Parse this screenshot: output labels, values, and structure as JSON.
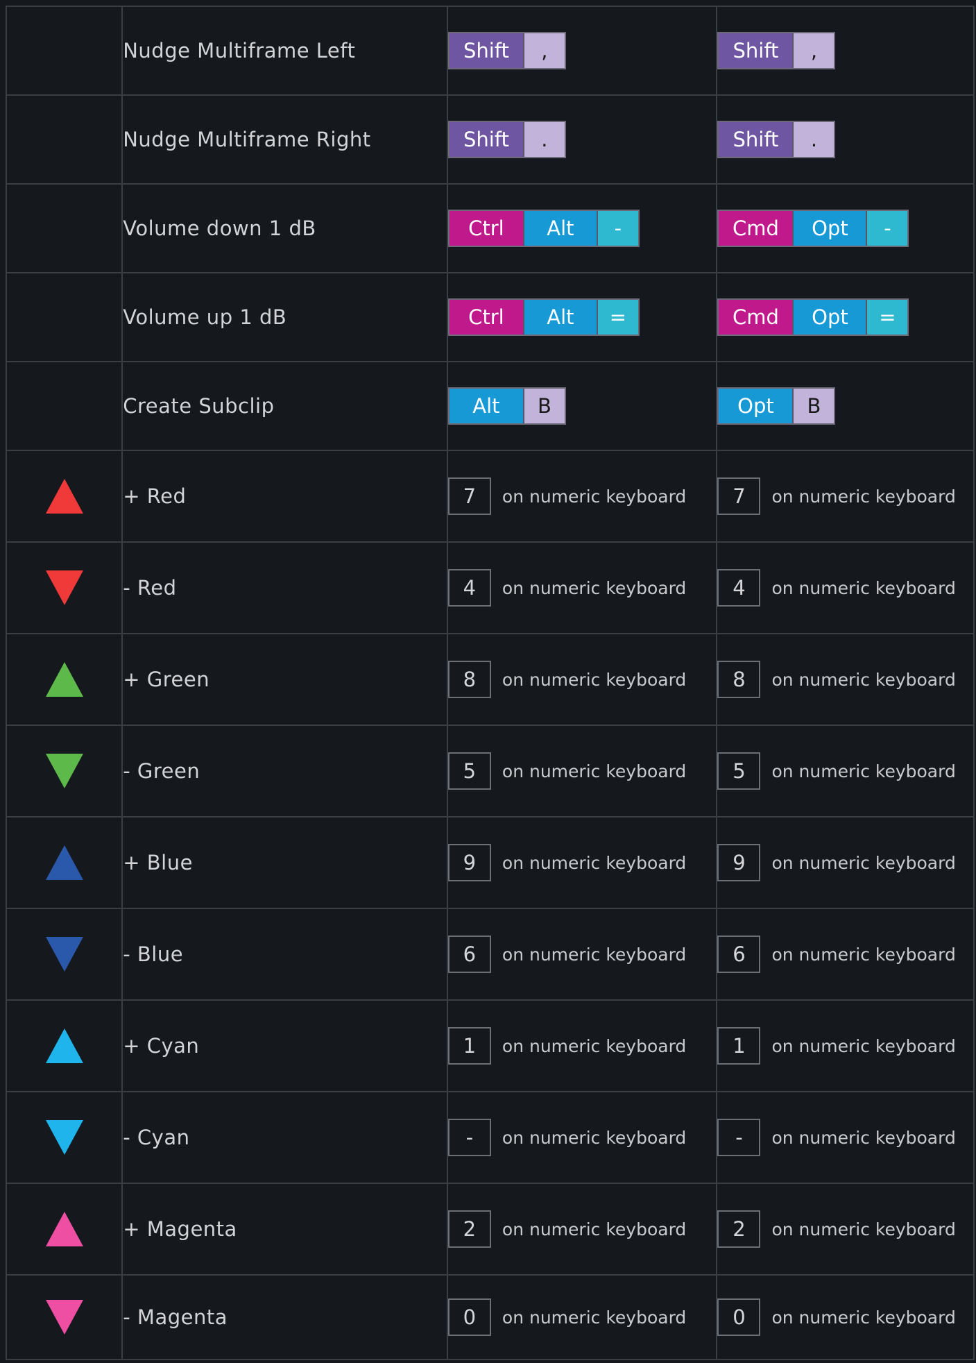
{
  "colors": {
    "red": "#f03a3a",
    "green": "#5cb94a",
    "blue": "#2a59ab",
    "cyan": "#1fb4ec",
    "magenta": "#ee4fa2",
    "shift_key": "#6f56a3",
    "ctrl_key": "#c0198b",
    "alt_key": "#1799d6",
    "light_key": "#c1b3d9",
    "teal_key": "#2fb9d0",
    "background": "#15181d",
    "border": "#3a3f46"
  },
  "shortcut_rows": [
    {
      "name": "Nudge Multiframe Left",
      "windows": [
        {
          "label": "Shift",
          "style": "shift"
        },
        {
          "label": ",",
          "style": "light"
        }
      ],
      "mac": [
        {
          "label": "Shift",
          "style": "shift"
        },
        {
          "label": ",",
          "style": "light"
        }
      ]
    },
    {
      "name": "Nudge Multiframe Right",
      "windows": [
        {
          "label": "Shift",
          "style": "shift"
        },
        {
          "label": ".",
          "style": "light"
        }
      ],
      "mac": [
        {
          "label": "Shift",
          "style": "shift"
        },
        {
          "label": ".",
          "style": "light"
        }
      ]
    },
    {
      "name": "Volume down 1 dB",
      "windows": [
        {
          "label": "Ctrl",
          "style": "ctrl"
        },
        {
          "label": "Alt",
          "style": "alt"
        },
        {
          "label": "-",
          "style": "teal"
        }
      ],
      "mac": [
        {
          "label": "Cmd",
          "style": "ctrl"
        },
        {
          "label": "Opt",
          "style": "alt"
        },
        {
          "label": "-",
          "style": "teal"
        }
      ]
    },
    {
      "name": "Volume up 1 dB",
      "windows": [
        {
          "label": "Ctrl",
          "style": "ctrl"
        },
        {
          "label": "Alt",
          "style": "alt"
        },
        {
          "label": "=",
          "style": "teal"
        }
      ],
      "mac": [
        {
          "label": "Cmd",
          "style": "ctrl"
        },
        {
          "label": "Opt",
          "style": "alt"
        },
        {
          "label": "=",
          "style": "teal"
        }
      ]
    },
    {
      "name": "Create Subclip",
      "windows": [
        {
          "label": "Alt",
          "style": "alt"
        },
        {
          "label": "B",
          "style": "light"
        }
      ],
      "mac": [
        {
          "label": "Opt",
          "style": "alt"
        },
        {
          "label": "B",
          "style": "light"
        }
      ]
    }
  ],
  "color_rows": [
    {
      "icon": "red-triangle-up-icon",
      "direction": "up",
      "color": "red",
      "name": "+ Red",
      "key": "7",
      "suffix": "on numeric keyboard"
    },
    {
      "icon": "red-triangle-down-icon",
      "direction": "down",
      "color": "red",
      "name": "- Red",
      "key": "4",
      "suffix": "on numeric keyboard"
    },
    {
      "icon": "green-triangle-up-icon",
      "direction": "up",
      "color": "green",
      "name": "+ Green",
      "key": "8",
      "suffix": "on numeric keyboard"
    },
    {
      "icon": "green-triangle-down-icon",
      "direction": "down",
      "color": "green",
      "name": "- Green",
      "key": "5",
      "suffix": "on numeric keyboard"
    },
    {
      "icon": "blue-triangle-up-icon",
      "direction": "up",
      "color": "blue",
      "name": "+ Blue",
      "key": "9",
      "suffix": "on numeric keyboard"
    },
    {
      "icon": "blue-triangle-down-icon",
      "direction": "down",
      "color": "blue",
      "name": "- Blue",
      "key": "6",
      "suffix": "on numeric keyboard"
    },
    {
      "icon": "cyan-triangle-up-icon",
      "direction": "up",
      "color": "cyan",
      "name": "+ Cyan",
      "key": "1",
      "suffix": "on numeric keyboard"
    },
    {
      "icon": "cyan-triangle-down-icon",
      "direction": "down",
      "color": "cyan",
      "name": "- Cyan",
      "key": "-",
      "suffix": "on numeric keyboard"
    },
    {
      "icon": "magenta-triangle-up-icon",
      "direction": "up",
      "color": "magenta",
      "name": "+ Magenta",
      "key": "2",
      "suffix": "on numeric keyboard"
    },
    {
      "icon": "magenta-triangle-down-icon",
      "direction": "down",
      "color": "magenta",
      "name": "- Magenta",
      "key": "0",
      "suffix": "on numeric keyboard"
    }
  ]
}
